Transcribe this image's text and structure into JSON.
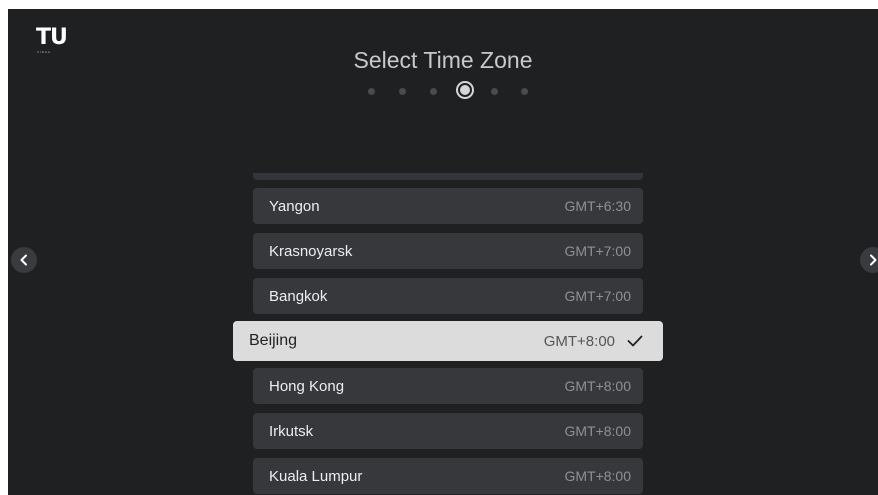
{
  "brand": {
    "logo": "TU",
    "sub": "VIDAA"
  },
  "page": {
    "title": "Select Time Zone"
  },
  "steps": {
    "count": 6,
    "active_index": 3
  },
  "timezones": [
    {
      "city": "Yangon",
      "offset": "GMT+6:30"
    },
    {
      "city": "Krasnoyarsk",
      "offset": "GMT+7:00"
    },
    {
      "city": "Bangkok",
      "offset": "GMT+7:00"
    },
    {
      "city": "Beijing",
      "offset": "GMT+8:00",
      "selected": true
    },
    {
      "city": "Hong Kong",
      "offset": "GMT+8:00"
    },
    {
      "city": "Irkutsk",
      "offset": "GMT+8:00"
    },
    {
      "city": "Kuala Lumpur",
      "offset": "GMT+8:00"
    }
  ],
  "icons": {
    "prev": "chevron-left-icon",
    "next": "chevron-right-icon",
    "check": "checkmark-icon"
  },
  "colors": {
    "background": "#1f2022",
    "row": "#37383c",
    "selected_row": "#dcdcdc"
  }
}
